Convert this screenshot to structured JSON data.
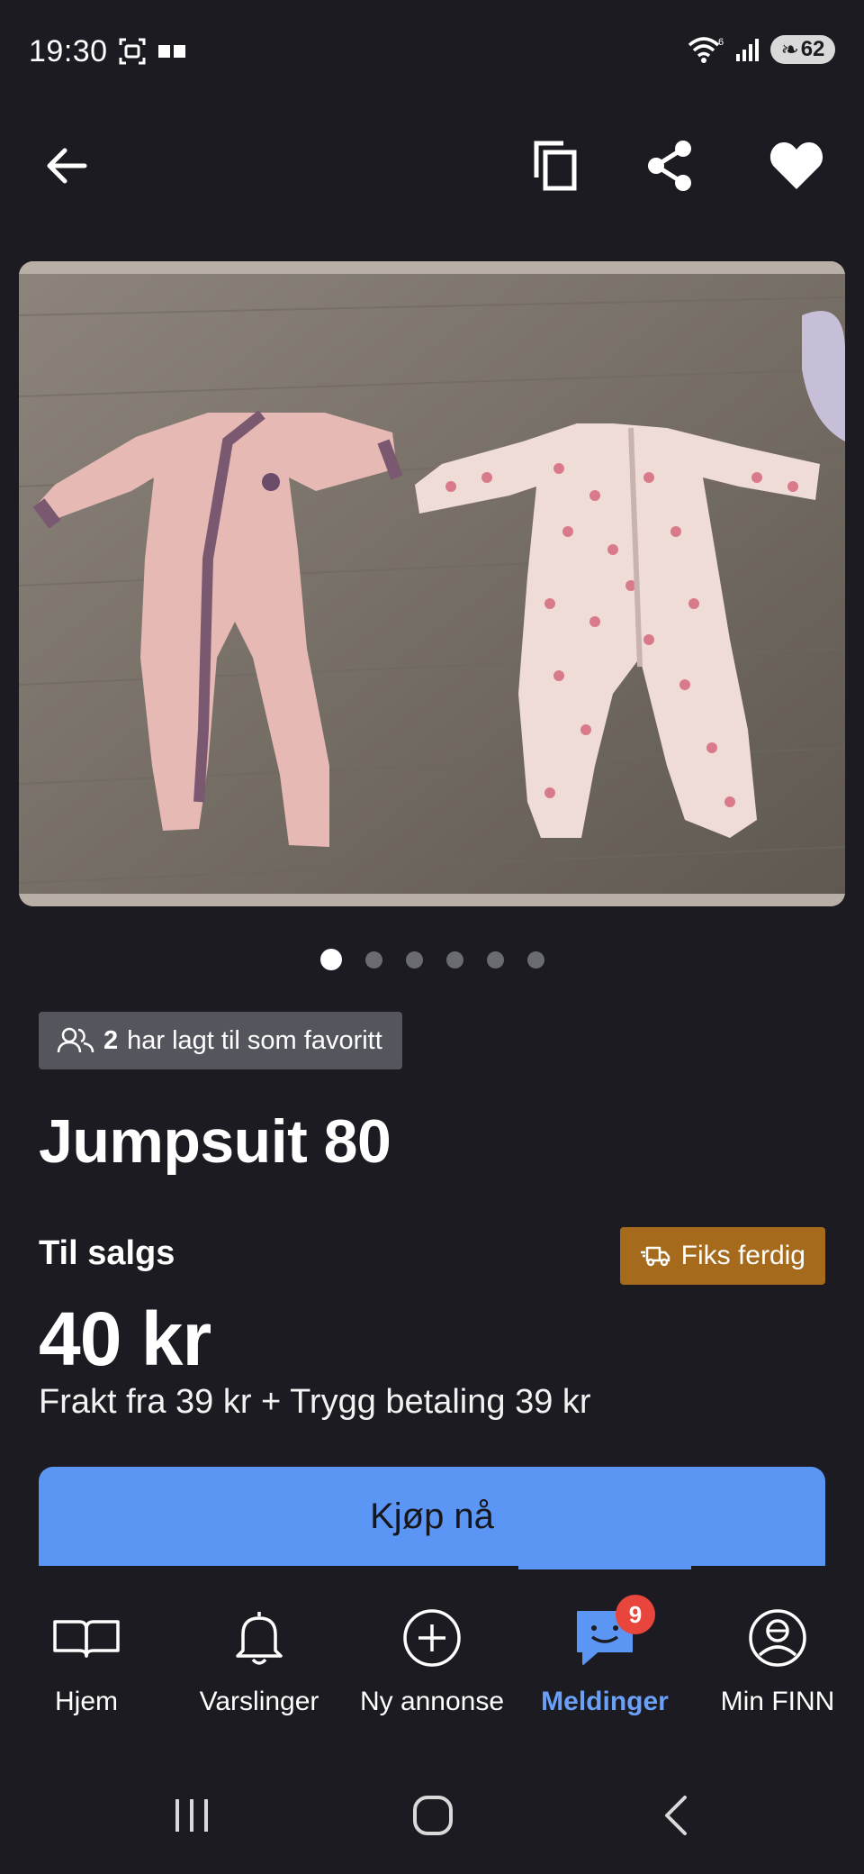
{
  "status_bar": {
    "time": "19:30",
    "battery": "62",
    "icons": [
      "screenshot-icon",
      "notification-icon",
      "wifi-icon",
      "signal-icon",
      "battery-icon"
    ]
  },
  "top_bar": {
    "icons": [
      "back-arrow-icon",
      "copy-icon",
      "share-icon",
      "heart-icon"
    ]
  },
  "gallery": {
    "image_count": 6,
    "active_index": 0
  },
  "favorites": {
    "count": "2",
    "text": "har lagt til som favoritt"
  },
  "listing": {
    "title": "Jumpsuit 80",
    "sale_label": "Til salgs",
    "fiks_ferdig": "Fiks ferdig",
    "price": "40 kr",
    "shipping": "Frakt fra 39 kr + Trygg betaling 39 kr",
    "buy_button": "Kjøp nå"
  },
  "bottom_nav": {
    "items": [
      {
        "label": "Hjem",
        "icon": "book-icon",
        "active": false
      },
      {
        "label": "Varslinger",
        "icon": "bell-icon",
        "active": false
      },
      {
        "label": "Ny annonse",
        "icon": "plus-circle-icon",
        "active": false
      },
      {
        "label": "Meldinger",
        "icon": "chat-icon",
        "active": true,
        "badge": "9"
      },
      {
        "label": "Min FINN",
        "icon": "profile-icon",
        "active": false
      }
    ]
  },
  "colors": {
    "background": "#1b1b21",
    "accent": "#5c96f5",
    "fiks_badge": "#a66a1c",
    "notification_badge": "#e8453c"
  }
}
